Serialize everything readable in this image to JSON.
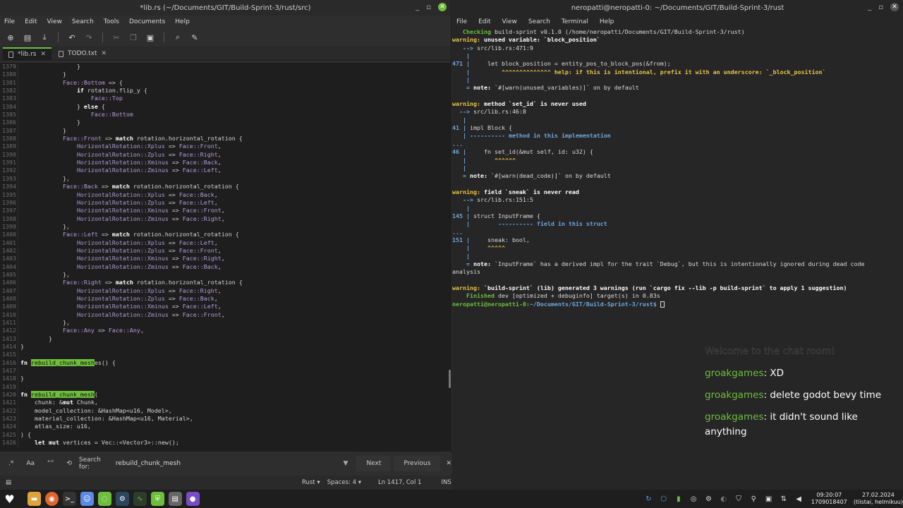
{
  "editor": {
    "title": "*lib.rs (~/Documents/GIT/Build-Sprint-3/rust/src)",
    "menu": [
      "File",
      "Edit",
      "View",
      "Search",
      "Tools",
      "Documents",
      "Help"
    ],
    "tabs": [
      {
        "label": "*lib.rs"
      },
      {
        "label": "TODO.txt"
      }
    ],
    "code_lines": [
      {
        "n": "1379",
        "t": "                }"
      },
      {
        "n": "1380",
        "t": "            }"
      },
      {
        "n": "1381",
        "t": "            Face::Bottom => {"
      },
      {
        "n": "1382",
        "t": "                if rotation.flip_y {"
      },
      {
        "n": "1383",
        "t": "                    Face::Top"
      },
      {
        "n": "1384",
        "t": "                } else {"
      },
      {
        "n": "1385",
        "t": "                    Face::Bottom"
      },
      {
        "n": "1386",
        "t": "                }"
      },
      {
        "n": "1387",
        "t": "            }"
      },
      {
        "n": "1388",
        "t": "            Face::Front => match rotation.horizontal_rotation {"
      },
      {
        "n": "1389",
        "t": "                HorizontalRotation::Xplus => Face::Front,"
      },
      {
        "n": "1390",
        "t": "                HorizontalRotation::Zplus => Face::Right,"
      },
      {
        "n": "1391",
        "t": "                HorizontalRotation::Xminus => Face::Back,"
      },
      {
        "n": "1392",
        "t": "                HorizontalRotation::Zminus => Face::Left,"
      },
      {
        "n": "1393",
        "t": "            },"
      },
      {
        "n": "1394",
        "t": "            Face::Back => match rotation.horizontal_rotation {"
      },
      {
        "n": "1395",
        "t": "                HorizontalRotation::Xplus => Face::Back,"
      },
      {
        "n": "1396",
        "t": "                HorizontalRotation::Zplus => Face::Left,"
      },
      {
        "n": "1397",
        "t": "                HorizontalRotation::Xminus => Face::Front,"
      },
      {
        "n": "1398",
        "t": "                HorizontalRotation::Zminus => Face::Right,"
      },
      {
        "n": "1399",
        "t": "            },"
      },
      {
        "n": "1400",
        "t": "            Face::Left => match rotation.horizontal_rotation {"
      },
      {
        "n": "1401",
        "t": "                HorizontalRotation::Xplus => Face::Left,"
      },
      {
        "n": "1402",
        "t": "                HorizontalRotation::Zplus => Face::Front,"
      },
      {
        "n": "1403",
        "t": "                HorizontalRotation::Xminus => Face::Right,"
      },
      {
        "n": "1404",
        "t": "                HorizontalRotation::Zminus => Face::Back,"
      },
      {
        "n": "1405",
        "t": "            },"
      },
      {
        "n": "1406",
        "t": "            Face::Right => match rotation.horizontal_rotation {"
      },
      {
        "n": "1407",
        "t": "                HorizontalRotation::Xplus => Face::Right,"
      },
      {
        "n": "1408",
        "t": "                HorizontalRotation::Zplus => Face::Back,"
      },
      {
        "n": "1409",
        "t": "                HorizontalRotation::Xminus => Face::Left,"
      },
      {
        "n": "1410",
        "t": "                HorizontalRotation::Zminus => Face::Front,"
      },
      {
        "n": "1411",
        "t": "            },"
      },
      {
        "n": "1412",
        "t": "            Face::Any => Face::Any,"
      },
      {
        "n": "1413",
        "t": "        }"
      },
      {
        "n": "1414",
        "t": "}"
      },
      {
        "n": "1415",
        "t": ""
      },
      {
        "n": "1416",
        "t": "fn rebuild_chunk_meshes() {"
      },
      {
        "n": "1417",
        "t": ""
      },
      {
        "n": "1418",
        "t": "}"
      },
      {
        "n": "1419",
        "t": ""
      },
      {
        "n": "1420",
        "t": "fn rebuild_chunk_mesh("
      },
      {
        "n": "1421",
        "t": "    chunk: &mut Chunk,"
      },
      {
        "n": "1422",
        "t": "    model_collection: &HashMap<u16, Model>,"
      },
      {
        "n": "1423",
        "t": "    material_collection: &HashMap<u16, Material>,"
      },
      {
        "n": "1424",
        "t": "    atlas_size: u16,"
      },
      {
        "n": "1425",
        "t": ") {"
      },
      {
        "n": "1426",
        "t": "    let mut vertices = Vec::<Vector3>::new();"
      }
    ],
    "search": {
      "label": "Search for:",
      "value": "rebuild_chunk_mesh",
      "next": "Next",
      "previous": "Previous",
      "regex": ".*",
      "case": "Aa",
      "quote": "“”"
    },
    "status": {
      "language": "Rust",
      "spaces": "Spaces: 4",
      "position": "Ln 1417, Col 1",
      "mode": "INS"
    }
  },
  "terminal": {
    "title": "neropatti@neropatti-0: ~/Documents/GIT/Build-Sprint-3/rust",
    "menu": [
      "File",
      "Edit",
      "View",
      "Search",
      "Terminal",
      "Help"
    ],
    "lines": [
      "   Checking build-sprint v0.1.0 (/home/neropatti/Documents/GIT/Build-Sprint-3/rust)",
      "warning: unused variable: `block_position`",
      "   --> src/lib.rs:471:9",
      "    |",
      "471 |     let block_position = entity_pos_to_block_pos(&from);",
      "    |         ^^^^^^^^^^^^^^ help: if this is intentional, prefix it with an underscore: `_block_position`",
      "    |",
      "    = note: `#[warn(unused_variables)]` on by default",
      "",
      "warning: method `set_id` is never used",
      "  --> src/lib.rs:46:8",
      "   |",
      "41 | impl Block {",
      "   | ---------- method in this implementation",
      "...",
      "46 |     fn set_id(&mut self, id: u32) {",
      "   |        ^^^^^^",
      "   |",
      "   = note: `#[warn(dead_code)]` on by default",
      "",
      "warning: field `sneak` is never read",
      "   --> src/lib.rs:151:5",
      "    |",
      "145 | struct InputFrame {",
      "    |        ---------- field in this struct",
      "...",
      "151 |     sneak: bool,",
      "    |     ^^^^^",
      "    |",
      "    = note: `InputFrame` has a derived impl for the trait `Debug`, but this is intentionally ignored during dead code",
      "analysis",
      "",
      "warning: `build-sprint` (lib) generated 3 warnings (run `cargo fix --lib -p build-sprint` to apply 1 suggestion)",
      "    Finished dev [optimized + debuginfo] target(s) in 0.83s",
      "neropatti@neropatti-0:~/Documents/GIT/Build-Sprint-3/rust$ "
    ]
  },
  "chat": {
    "welcome": "Welcome to the chat room!",
    "messages": [
      {
        "user": "groakgames",
        "text": ": XD"
      },
      {
        "user": "groakgames",
        "text": ": delete godot bevy time"
      },
      {
        "user": "groakgames",
        "text": ": it didn't sound like anything"
      }
    ]
  },
  "taskbar": {
    "time": "09:20:07",
    "unix": "1709018407",
    "date": "27.02.2024",
    "day": "(tiistai, helmikuu)"
  }
}
